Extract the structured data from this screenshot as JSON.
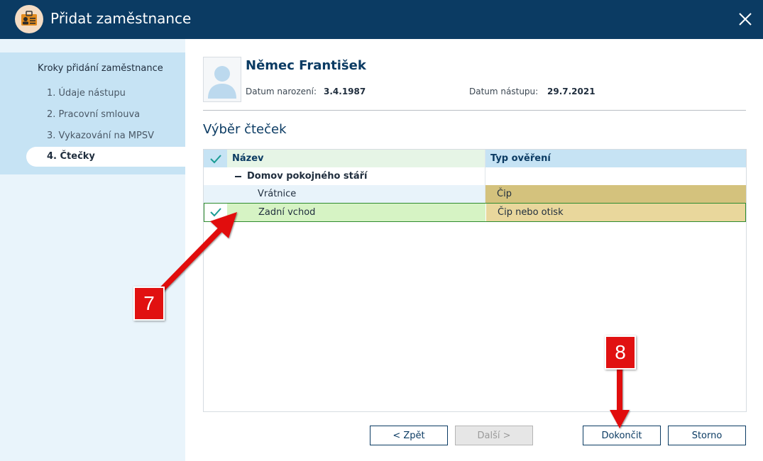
{
  "window": {
    "title": "Přidat zaměstnance",
    "accent_color": "#0b3b63"
  },
  "sidebar": {
    "heading": "Kroky přidání zaměstnance",
    "steps": [
      {
        "label": "1. Údaje nástupu"
      },
      {
        "label": "2. Pracovní smlouva"
      },
      {
        "label": "3. Vykazování na MPSV"
      },
      {
        "label": "4. Čtečky",
        "active": true
      }
    ]
  },
  "employee": {
    "name": "Němec František",
    "birth_label": "Datum narození:",
    "birth_value": "3.4.1987",
    "start_label": "Datum nástupu:",
    "start_value": "29.7.2021"
  },
  "section_title": "Výběr čteček",
  "table": {
    "headers": {
      "name": "Název",
      "type": "Typ ověření"
    },
    "group": {
      "label": "Domov pokojného stáří"
    },
    "rows": [
      {
        "name": "Vrátnice",
        "type": "Čip",
        "checked": false
      },
      {
        "name": "Zadní vchod",
        "type": "Čip nebo otisk",
        "checked": true
      }
    ]
  },
  "buttons": {
    "back": "< Zpět",
    "next": "Další >",
    "finish": "Dokončit",
    "cancel": "Storno"
  },
  "annotations": {
    "marker_7": "7",
    "marker_8": "8"
  }
}
